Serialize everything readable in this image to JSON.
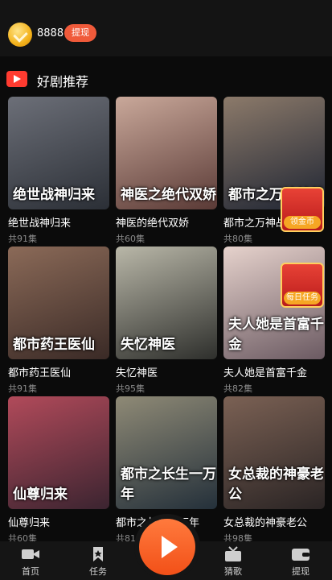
{
  "header": {
    "balance": "8888",
    "withdraw_label": "提现"
  },
  "section": {
    "title": "好剧推荐"
  },
  "dramas": [
    {
      "title": "绝世战神归来",
      "episodes": "共91集",
      "poster_text": "绝世战神归来",
      "c1": "#2b2f36",
      "c2": "#6c6f78"
    },
    {
      "title": "神医的绝代双娇",
      "episodes": "共60集",
      "poster_text": "神医之绝代双娇",
      "c1": "#5a3a36",
      "c2": "#c9a89a"
    },
    {
      "title": "都市之万神战尊",
      "episodes": "共80集",
      "poster_text": "都市之万神战尊",
      "c1": "#1f2533",
      "c2": "#8c7a6a"
    },
    {
      "title": "都市药王医仙",
      "episodes": "共91集",
      "poster_text": "都市药王医仙",
      "c1": "#3a2a26",
      "c2": "#8b6a58"
    },
    {
      "title": "失忆神医",
      "episodes": "共95集",
      "poster_text": "失忆神医",
      "c1": "#2e2f2c",
      "c2": "#b9b7a8"
    },
    {
      "title": "夫人她是首富千金",
      "episodes": "共82集",
      "poster_text": "夫人她是首富千金",
      "c1": "#6b5a62",
      "c2": "#e6d2cc"
    },
    {
      "title": "仙尊归来",
      "episodes": "共60集",
      "poster_text": "仙尊归来",
      "c1": "#3b2430",
      "c2": "#b14a5a"
    },
    {
      "title": "都市之长生一万年",
      "episodes": "共81集",
      "poster_text": "都市之长生一万年",
      "c1": "#24303a",
      "c2": "#8f8a76"
    },
    {
      "title": "女总裁的神豪老公",
      "episodes": "共98集",
      "poster_text": "女总裁的神豪老公",
      "c1": "#2a2424",
      "c2": "#7b6154"
    }
  ],
  "floating": {
    "coins_label": "领金币",
    "daily_task_label": "每日任务"
  },
  "tabbar": {
    "home": "首页",
    "tasks": "任务",
    "theater": "猜歌",
    "withdraw": "提现"
  },
  "colors": {
    "accent": "#f25018",
    "tag_red": "#ff3b30"
  }
}
